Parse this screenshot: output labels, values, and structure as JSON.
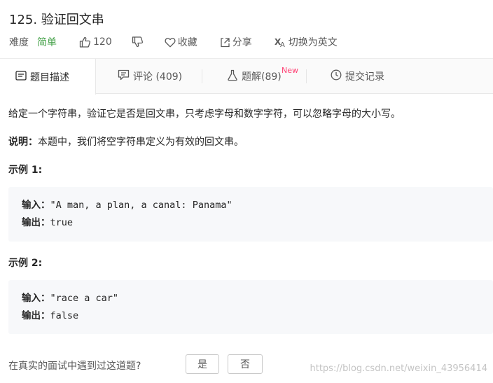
{
  "problem": {
    "title": "125. 验证回文串",
    "difficulty_label": "难度",
    "difficulty_value": "简单",
    "likes": "120",
    "favorite_label": "收藏",
    "share_label": "分享",
    "switch_lang_label": "切换为英文"
  },
  "tabs": [
    {
      "label": "题目描述",
      "icon": "description-icon"
    },
    {
      "label": "评论 (409)",
      "icon": "comment-icon"
    },
    {
      "label": "题解(89)",
      "icon": "flask-icon",
      "badge": "New"
    },
    {
      "label": "提交记录",
      "icon": "clock-icon"
    }
  ],
  "content": {
    "description": "给定一个字符串，验证它是否是回文串，只考虑字母和数字字符，可以忽略字母的大小写。",
    "note_label": "说明：",
    "note_text": "本题中，我们将空字符串定义为有效的回文串。",
    "examples": [
      {
        "title": "示例 1:",
        "input_label": "输入：",
        "input": "\"A man, a plan, a canal: Panama\"",
        "output_label": "输出：",
        "output": "true"
      },
      {
        "title": "示例 2:",
        "input_label": "输入：",
        "input": "\"race a car\"",
        "output_label": "输出：",
        "output": "false"
      }
    ]
  },
  "footer": {
    "question": "在真实的面试中遇到过这道题?",
    "yes_label": "是",
    "no_label": "否"
  },
  "watermark": "https://blog.csdn.net/weixin_43956414",
  "colors": {
    "difficulty_easy": "#43a047",
    "new_badge": "#ff3d71",
    "code_background": "#f7f8fa"
  }
}
